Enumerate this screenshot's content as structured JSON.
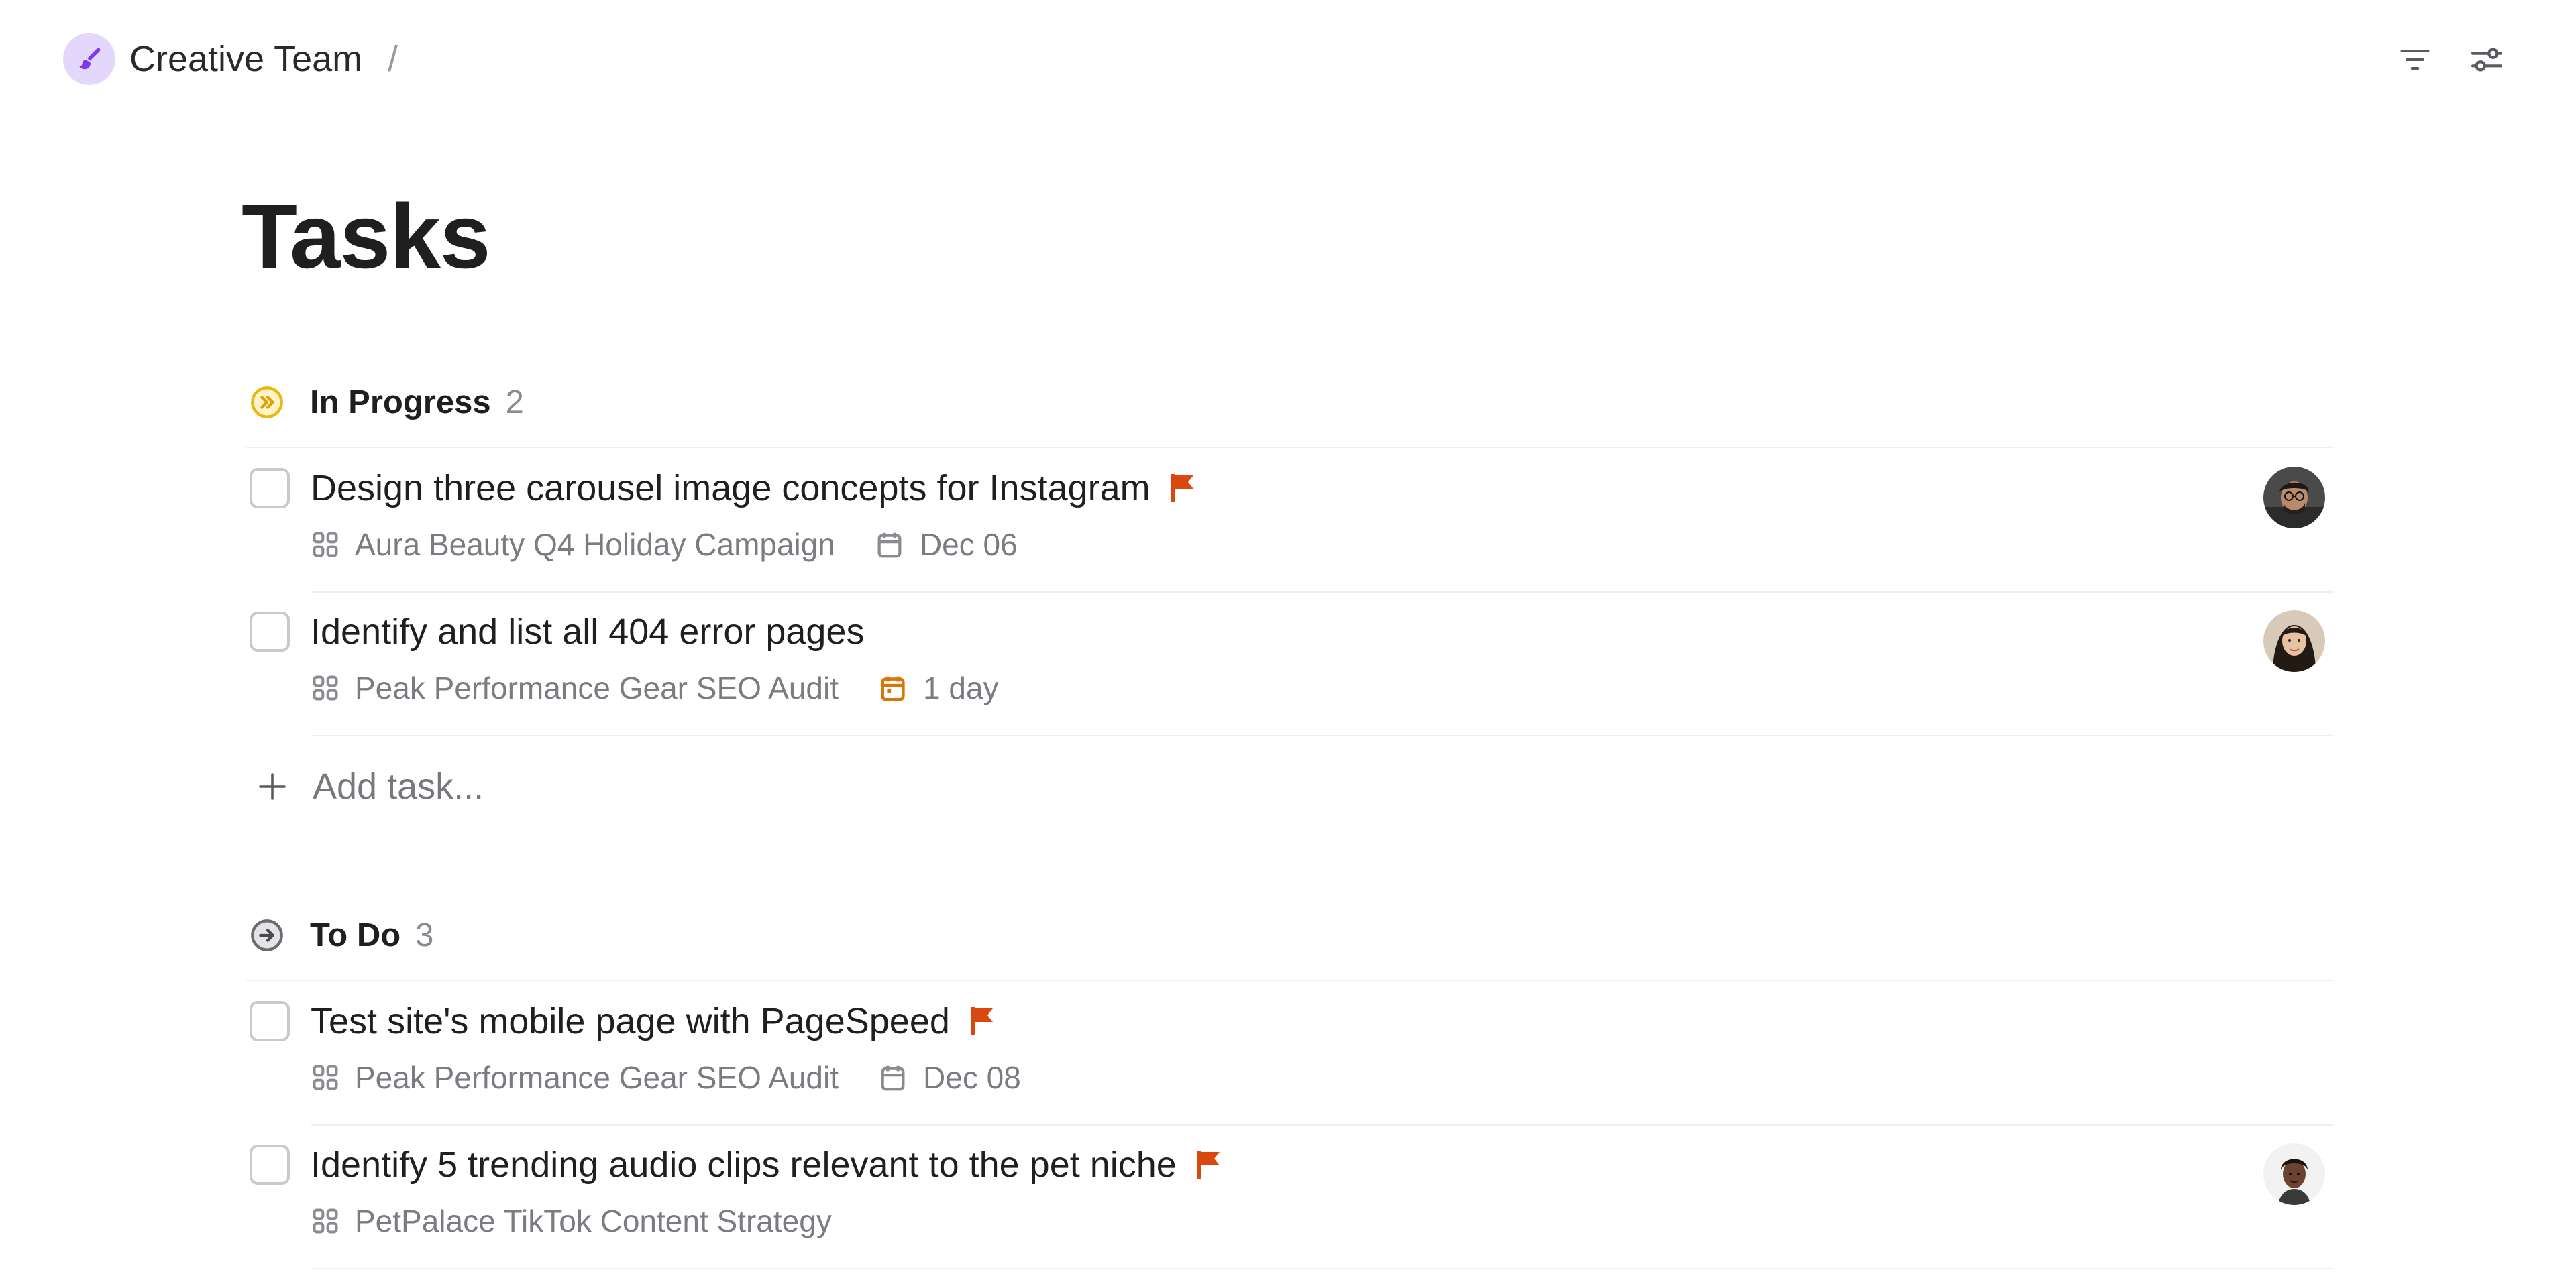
{
  "breadcrumb": {
    "team_name": "Creative Team",
    "separator": "/",
    "team_icon": "paintbrush-icon",
    "team_icon_color": "#7c3aed",
    "team_icon_bg": "#e3d7fb"
  },
  "toolbar": {
    "filter_icon": "filter-icon",
    "settings_icon": "sliders-icon"
  },
  "page": {
    "title": "Tasks"
  },
  "sections": [
    {
      "name": "In Progress",
      "count": "2",
      "status_icon": "in-progress-icon",
      "status_color": "#e8b914",
      "tasks": [
        {
          "title": "Design three carousel image concepts for Instagram",
          "flagged": true,
          "project": "Aura Beauty Q4 Holiday Campaign",
          "date": "Dec 06",
          "date_status": "normal",
          "avatar": "avatar-man-glasses"
        },
        {
          "title": "Identify and list all 404 error pages",
          "flagged": false,
          "project": "Peak Performance Gear SEO Audit",
          "date": "1 day",
          "date_status": "due-soon",
          "avatar": "avatar-woman"
        }
      ],
      "add_task_label": "Add task..."
    },
    {
      "name": "To Do",
      "count": "3",
      "status_icon": "todo-icon",
      "status_color": "#6b6b72",
      "tasks": [
        {
          "title": "Test site's mobile page with PageSpeed",
          "flagged": true,
          "project": "Peak Performance Gear SEO Audit",
          "date": "Dec 08",
          "date_status": "normal",
          "avatar": ""
        },
        {
          "title": "Identify 5 trending audio clips relevant to the pet niche",
          "flagged": true,
          "project": "PetPalace TikTok Content Strategy",
          "date": "",
          "date_status": "none",
          "avatar": "avatar-man-curly"
        }
      ]
    }
  ],
  "colors": {
    "flag": "#d9480f",
    "due_soon": "#d97706",
    "muted_text": "#7b7b82"
  }
}
